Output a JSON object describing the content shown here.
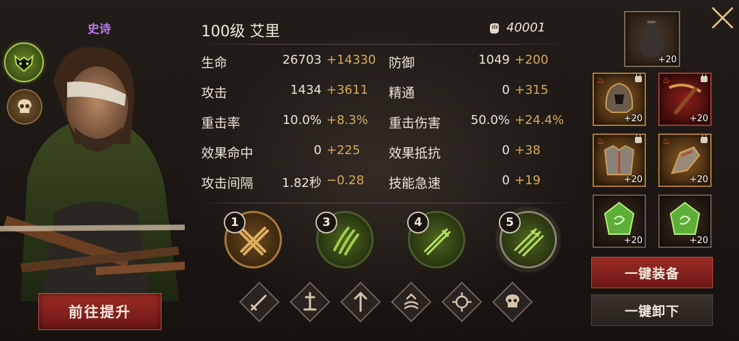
{
  "hero": {
    "rarity": "史诗",
    "title": "100级  艾里",
    "power": "40001",
    "upgrade_button": "前往提升"
  },
  "stats": [
    {
      "label": "生命",
      "value": "26703",
      "bonus": "+14330",
      "label2": "防御",
      "value2": "1049",
      "bonus2": "+200"
    },
    {
      "label": "攻击",
      "value": "1434",
      "bonus": "+3611",
      "label2": "精通",
      "value2": "0",
      "bonus2": "+315"
    },
    {
      "label": "重击率",
      "value": "10.0%",
      "bonus": "+8.3%",
      "label2": "重击伤害",
      "value2": "50.0%",
      "bonus2": "+24.4%"
    },
    {
      "label": "效果命中",
      "value": "0",
      "bonus": "+225",
      "label2": "效果抵抗",
      "value2": "0",
      "bonus2": "+38"
    },
    {
      "label": "攻击间隔",
      "value": "1.82秒",
      "bonus": "−0.28",
      "label2": "技能急速",
      "value2": "0",
      "bonus2": "+19"
    }
  ],
  "skills": [
    {
      "number": "1",
      "icon": "crossed-bolts-icon"
    },
    {
      "number": "3",
      "icon": "claw-slash-icon"
    },
    {
      "number": "4",
      "icon": "arrow-volley-icon"
    },
    {
      "number": "5",
      "icon": "triple-arrow-icon"
    }
  ],
  "passive_slots": [
    "sword-icon",
    "sword-in-stone-icon",
    "arrow-up-icon",
    "wave-up-icon",
    "crosshair-icon",
    "skull-icon"
  ],
  "equipment": {
    "top_slot_level": "+20",
    "items": [
      {
        "name": "helmet",
        "level": "+20"
      },
      {
        "name": "crossbow",
        "level": "+20"
      },
      {
        "name": "chest-armor",
        "level": "+20"
      },
      {
        "name": "gauntlet",
        "level": "+20"
      },
      {
        "name": "green-gem-left",
        "level": "+20"
      },
      {
        "name": "green-gem-right",
        "level": "+20"
      }
    ]
  },
  "buttons": {
    "equip_all": "一键装备",
    "unequip_all": "一键卸下"
  },
  "colors": {
    "bonus": "#d9a85a",
    "rarity": "#b679f0",
    "primary_button": "#9b2b26"
  }
}
